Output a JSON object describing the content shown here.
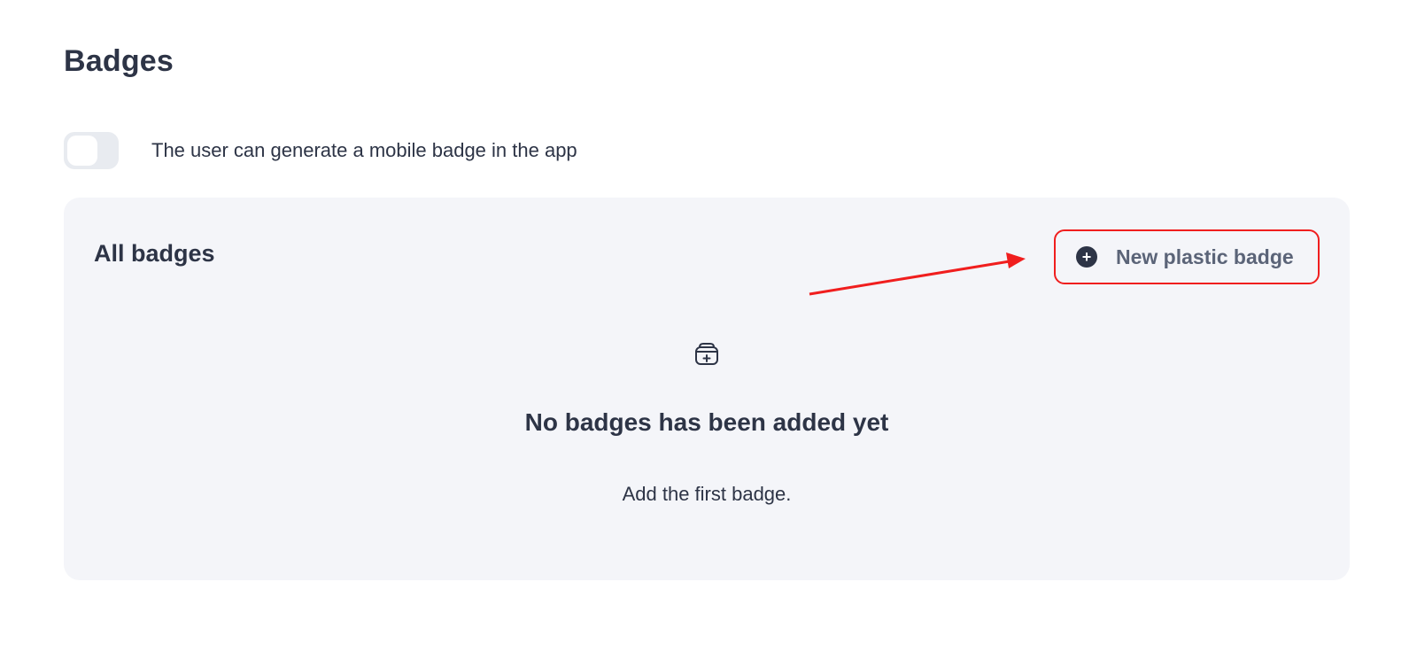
{
  "page": {
    "title": "Badges"
  },
  "settings": {
    "mobile_badge_toggle": {
      "enabled": false,
      "label": "The user can generate a mobile badge in the app"
    }
  },
  "badges_panel": {
    "title": "All badges",
    "new_button": {
      "label": "New plastic badge",
      "icon": "plus-circle-icon"
    },
    "empty_state": {
      "icon": "badge-holder-add-icon",
      "title": "No badges has been added yet",
      "subtitle": "Add the first badge."
    }
  },
  "annotation": {
    "color": "#f01e1e",
    "type": "arrow pointing to button"
  },
  "colors": {
    "text_primary": "#2d3446",
    "text_secondary": "#5b6478",
    "panel_bg": "#f4f5f9",
    "toggle_off": "#e8ebf0"
  }
}
